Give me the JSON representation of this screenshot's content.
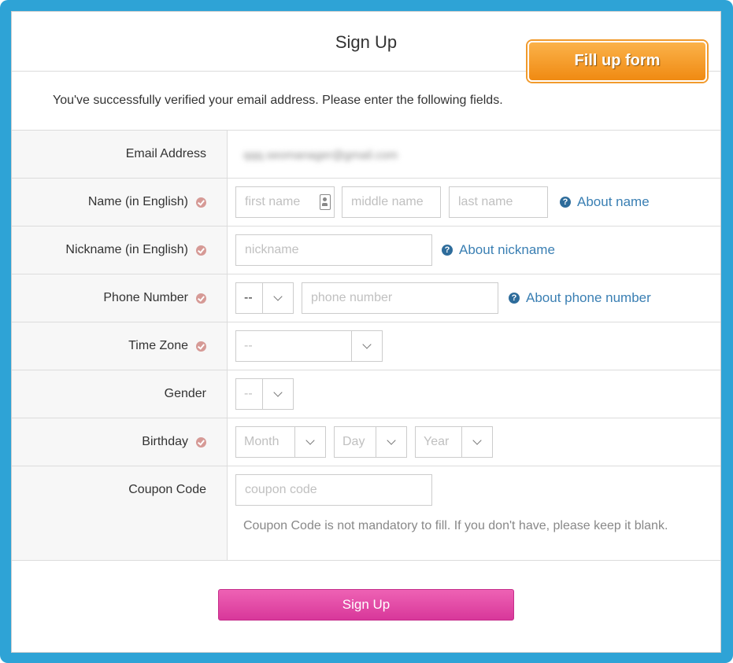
{
  "page": {
    "title": "Sign Up",
    "badge": "Fill up form",
    "intro": "You've successfully verified your email address. Please enter the following fields."
  },
  "fields": {
    "email": {
      "label": "Email Address",
      "value": "qqq.seomanager@gmail.com"
    },
    "name": {
      "label": "Name (in English)",
      "first_placeholder": "first name",
      "middle_placeholder": "middle name",
      "last_placeholder": "last name",
      "help": "About name"
    },
    "nickname": {
      "label": "Nickname (in English)",
      "placeholder": "nickname",
      "help": "About nickname"
    },
    "phone": {
      "label": "Phone Number",
      "country_code": "--",
      "placeholder": "phone number",
      "help": "About phone number"
    },
    "timezone": {
      "label": "Time Zone",
      "value": "--"
    },
    "gender": {
      "label": "Gender",
      "value": "--"
    },
    "birthday": {
      "label": "Birthday",
      "month": "Month",
      "day": "Day",
      "year": "Year"
    },
    "coupon": {
      "label": "Coupon Code",
      "placeholder": "coupon code",
      "note": "Coupon Code is not mandatory to fill. If you don't have, please keep it blank."
    }
  },
  "actions": {
    "submit_label": "Sign Up"
  },
  "colors": {
    "frame": "#2ea3d6",
    "badge": "#f39a2a",
    "submit": "#e04aa8",
    "help_link": "#3a7fb3",
    "required_mark": "#d69a96"
  },
  "icons": {
    "required": "check-circle-icon",
    "help": "question-circle-icon",
    "contact_card": "contact-card-icon",
    "dropdown": "chevron-down-icon"
  }
}
